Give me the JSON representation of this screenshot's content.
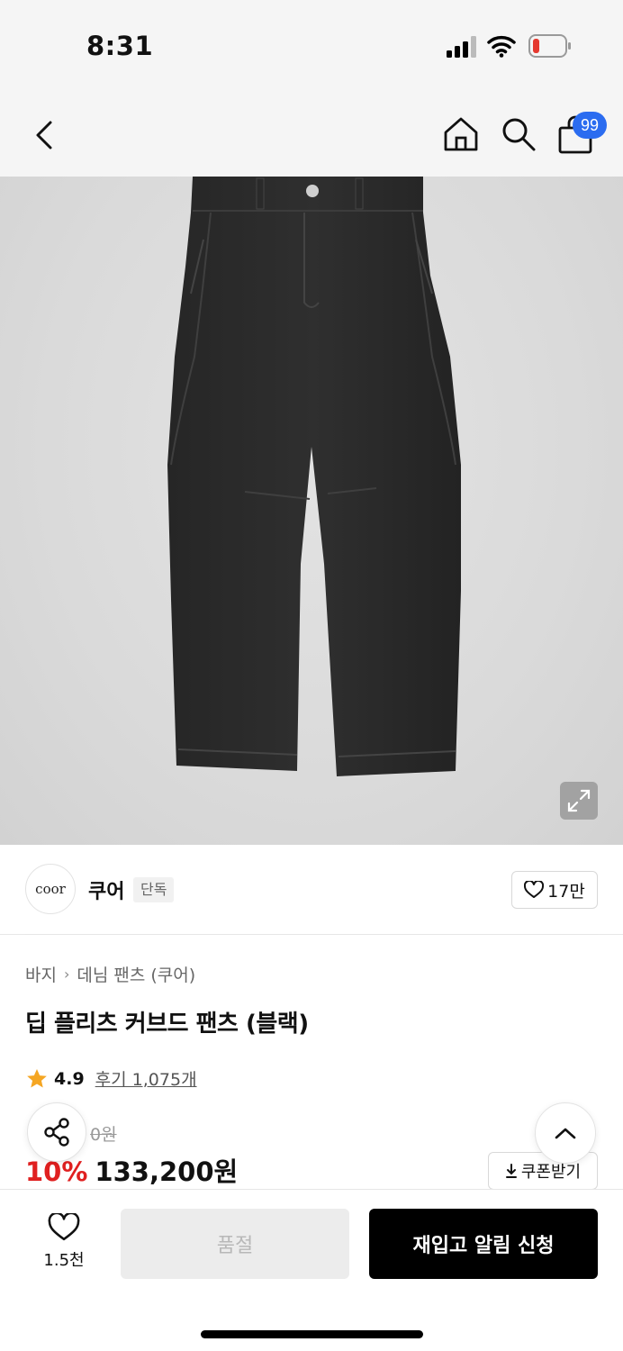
{
  "status_bar": {
    "time": "8:31"
  },
  "header": {
    "cart_count": "99"
  },
  "brand": {
    "logo_text": "coor",
    "name": "쿠어",
    "tag": "단독",
    "likes": "17만"
  },
  "breadcrumb": {
    "level1": "바지",
    "level2": "데님 팬츠 (쿠어)"
  },
  "product": {
    "title": "딥 플리츠 커브드 팬츠 (블랙)"
  },
  "rating": {
    "value": "4.9",
    "reviews_label": "후기 1,075개"
  },
  "price": {
    "original": "0원",
    "discount": "10%",
    "sale": "133,200원",
    "coupon_label": "쿠폰받기"
  },
  "bottom_bar": {
    "wish_count": "1.5천",
    "soldout_label": "품절",
    "restock_label": "재입고 알림 신청"
  },
  "colors": {
    "accent_red": "#e02020",
    "badge_blue": "#2b6cf0",
    "battery_red": "#e5392f"
  }
}
